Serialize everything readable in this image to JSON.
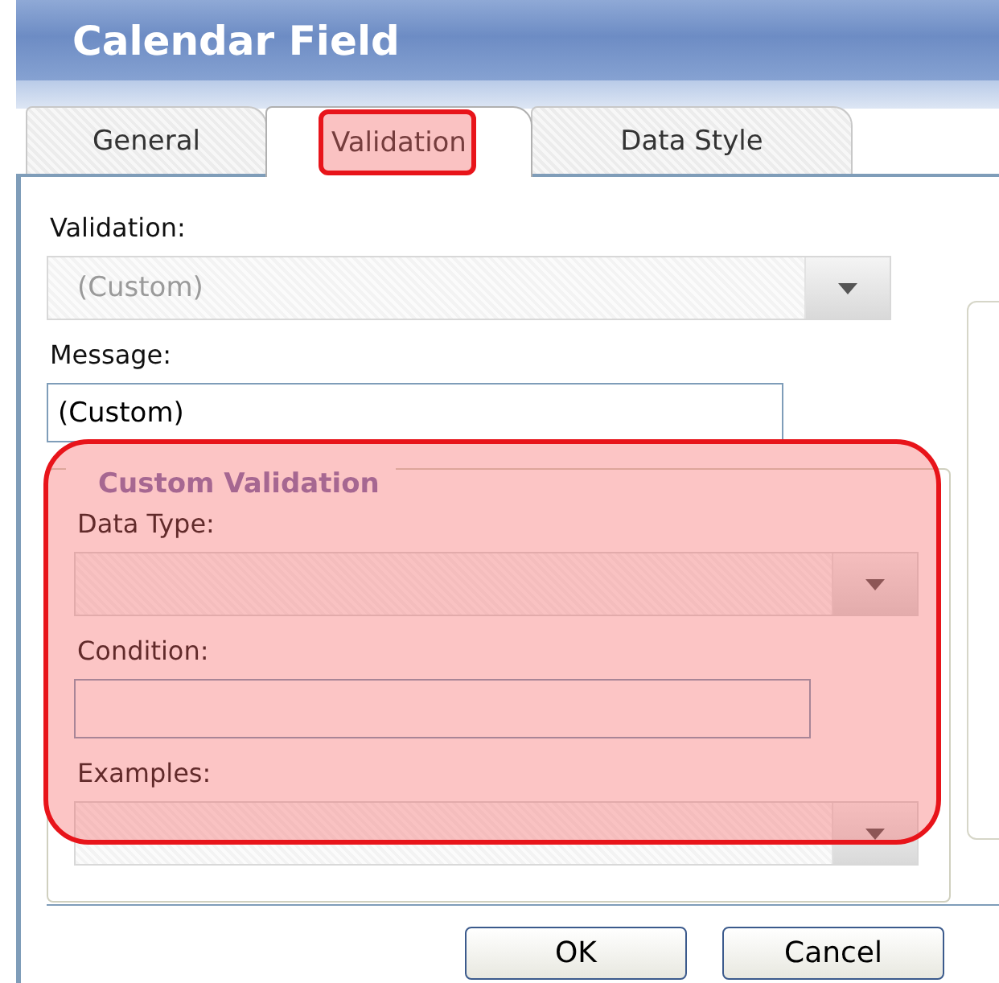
{
  "window": {
    "title": "Calendar Field"
  },
  "tabs": [
    {
      "label": "General",
      "selected": false,
      "highlighted": false
    },
    {
      "label": "Validation",
      "selected": true,
      "highlighted": true
    },
    {
      "label": "Data Style",
      "selected": false,
      "highlighted": false
    }
  ],
  "fields": [
    {
      "kind": "dropdown",
      "label": "Validation:",
      "value": "(Custom)",
      "disabled": true
    },
    {
      "kind": "text",
      "label": "Message:",
      "value": "(Custom)"
    }
  ],
  "group": {
    "title": "Custom Validation",
    "highlighted": true,
    "fields": [
      {
        "kind": "dropdown",
        "label": "Data Type:",
        "disabled": true
      },
      {
        "kind": "text",
        "label": "Condition:"
      },
      {
        "kind": "dropdown",
        "label": "Examples:",
        "disabled": true
      }
    ]
  },
  "buttons": [
    {
      "label": "OK"
    },
    {
      "label": "Cancel"
    }
  ]
}
